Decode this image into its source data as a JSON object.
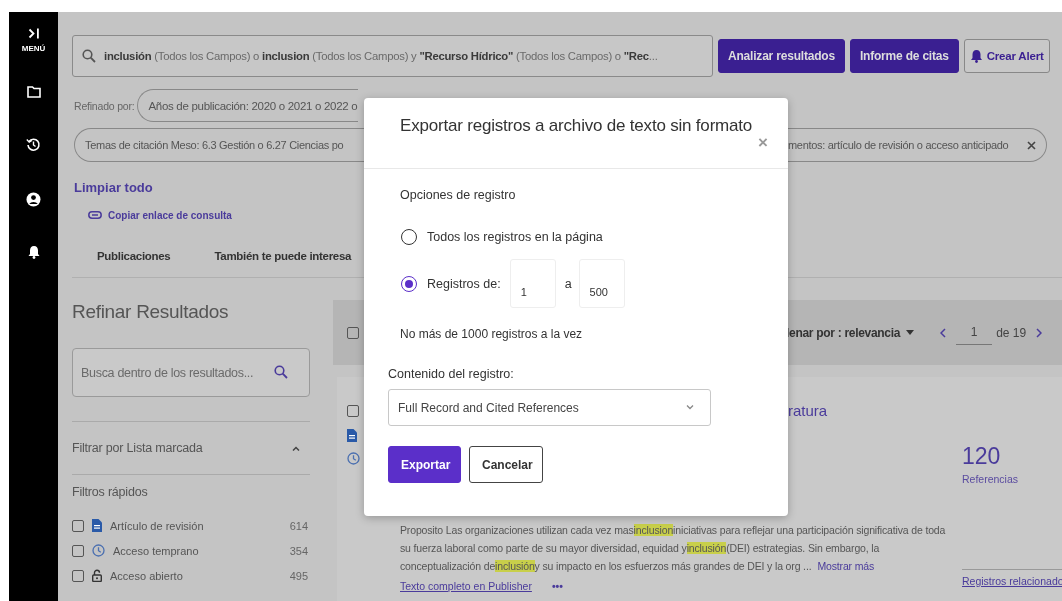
{
  "sidebar": {
    "menu_label": "MENÚ"
  },
  "search": {
    "query": "**inclusión** (Todos los Campos) o **inclusion** (Todos los Campos) y **\"Recurso Hídrico\"** (Todos los Campos) o **\"Rec**...",
    "buttons": [
      {
        "label": "Analizar resultados",
        "kind": "primary"
      },
      {
        "label": "Informe de citas",
        "kind": "primary"
      },
      {
        "label": "Crear Alert",
        "kind": "outline"
      }
    ]
  },
  "refined_by": {
    "label": "Refinado por:",
    "filters": [
      "Años de publicación: 2020 o 2021 o 2022 o"
    ]
  },
  "filters_row_2": {
    "left": "Temas de citación Meso: 6.3 Gestión o 6.27 Ciencias po",
    "right": "mentos: artículo de revisión o acceso anticipado"
  },
  "clear_all": "Limpiar todo",
  "copy_link": "Copiar enlace de consulta",
  "tabs": [
    {
      "label": "Publicaciones"
    },
    {
      "label": "También te puede interesa"
    }
  ],
  "refine_panel": {
    "title": "Refinar Resultados",
    "search_placeholder": "Busca dentro de los resultados...",
    "marked_list": {
      "label": "Filtrar por Lista marcada",
      "expanded": true
    },
    "quick_filters": {
      "title": "Filtros rápidos",
      "items": [
        {
          "label": "Artículo de revisión",
          "count": "614",
          "checked": false
        },
        {
          "label": "Acceso temprano",
          "count": "354",
          "checked": false
        },
        {
          "label": "Acceso abierto",
          "count": "495",
          "checked": false
        }
      ]
    }
  },
  "results": {
    "select_all_checked": false,
    "sort": "lenar por : relevancia",
    "page": "1",
    "page_total": "de 19",
    "item": {
      "checked": false,
      "title_fragment": "ratura",
      "citations": "120",
      "citations_label": "Referencias",
      "abstract": [
        {
          "text": "Proposito Las organizaciones utilizan cada vez mas",
          "highlighted": false
        },
        {
          "text": "inclusion",
          "highlighted": true
        },
        {
          "text": "iniciativas para reflejar una participación significativa de toda su fuerza laboral como parte de su mayor diversidad, equidad y",
          "highlighted": false
        },
        {
          "text": "inclusión",
          "highlighted": true
        },
        {
          "text": "(DEI) estrategias. Sin embargo, la conceptualización de",
          "highlighted": false
        },
        {
          "text": "inclusión",
          "highlighted": true
        },
        {
          "text": "y su impacto en los esfuerzos más grandes de DEI y la org ...",
          "highlighted": false
        }
      ],
      "show_more": "Mostrar más",
      "full_text": "Texto completo en Publisher",
      "more": "•••",
      "related": "Registros relacionado"
    }
  },
  "dialog": {
    "title": "Exportar registros a archivo de texto sin formato",
    "close": "×",
    "section": "Opciones de registro",
    "options": [
      {
        "kind": "plain",
        "label": "Todos los registros en la página",
        "selected": false
      },
      {
        "kind": "range",
        "label": "Registros de:",
        "selected": true,
        "from": "1",
        "separator": "a",
        "to": "500"
      }
    ],
    "note": "No más de 1000 registros a la vez",
    "content_label": "Contenido del registro:",
    "content_value": "Full Record and Cited References",
    "buttons": [
      {
        "label": "Exportar",
        "kind": "primary"
      },
      {
        "label": "Cancelar",
        "kind": "secondary"
      }
    ]
  }
}
